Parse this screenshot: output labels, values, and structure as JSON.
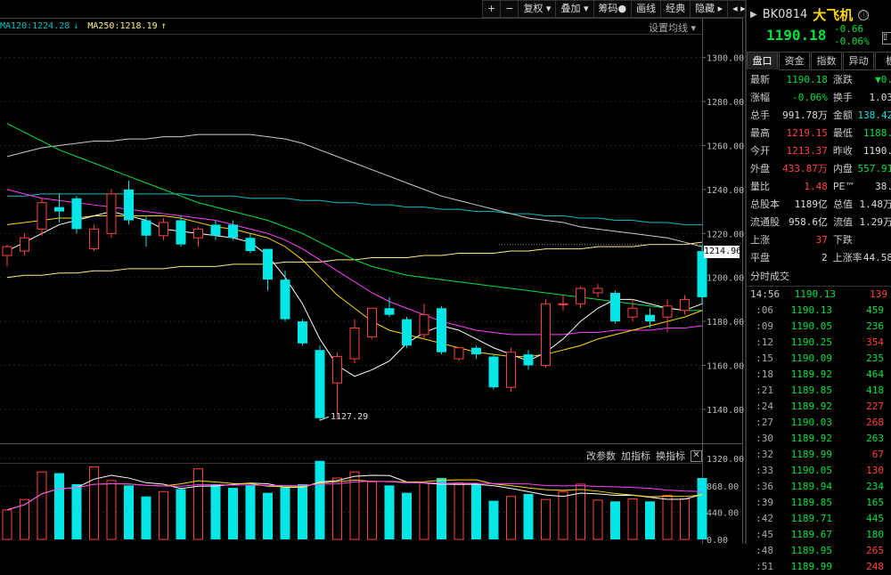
{
  "toolbar": {
    "buttons": [
      "+",
      "−",
      "复权 ▾",
      "叠加 ▾",
      "筹码●",
      "画线",
      "经典",
      "隐藏 ▸",
      "◂ ▸"
    ]
  },
  "legend": {
    "ma120": "MA120:1224.28",
    "ma120_arrow": "↓",
    "ma250": "MA250:1218.19",
    "ma250_arrow": "↑",
    "setting": "设置均线 ▾"
  },
  "colors": {
    "up": "#ff4040",
    "down": "#00e5e5",
    "ma5": "#ffffff",
    "ma10": "#ffd700",
    "ma20": "#ff40ff",
    "ma30": "#00e040",
    "ma60": "#cccccc",
    "ma120": "#00c0c0",
    "ma250": "#ffef80"
  },
  "current_price_tag": "1214.96",
  "min_label": "1127.29",
  "vol_tools": {
    "params": "改参数",
    "add": "加指标",
    "change": "换指标",
    "close": "✕"
  },
  "chart_data": {
    "type": "candlestick",
    "y_ticks": [
      "1300.00",
      "1280.00",
      "1260.00",
      "1240.00",
      "1220.00",
      "1200.00",
      "1180.00",
      "1160.00",
      "1140.00"
    ],
    "ylim": [
      1127,
      1310
    ],
    "vol_ticks": [
      "1320.00",
      "868.00",
      "440.00",
      "0.00"
    ],
    "vol_ylim": [
      0,
      1320
    ],
    "candles": [
      {
        "o": 1210,
        "h": 1215,
        "c": 1214,
        "l": 1205
      },
      {
        "o": 1212,
        "h": 1220,
        "c": 1218,
        "l": 1210
      },
      {
        "o": 1222,
        "h": 1236,
        "c": 1234,
        "l": 1219
      },
      {
        "o": 1232,
        "h": 1238,
        "c": 1230,
        "l": 1225
      },
      {
        "o": 1236,
        "h": 1237,
        "c": 1222,
        "l": 1220
      },
      {
        "o": 1213,
        "h": 1224,
        "c": 1222,
        "l": 1212
      },
      {
        "o": 1220,
        "h": 1240,
        "c": 1238,
        "l": 1218
      },
      {
        "o": 1240,
        "h": 1244,
        "c": 1226,
        "l": 1224
      },
      {
        "o": 1226,
        "h": 1228,
        "c": 1219,
        "l": 1214
      },
      {
        "o": 1219,
        "h": 1227,
        "c": 1225,
        "l": 1217
      },
      {
        "o": 1226,
        "h": 1228,
        "c": 1215,
        "l": 1214
      },
      {
        "o": 1218,
        "h": 1223,
        "c": 1222,
        "l": 1214
      },
      {
        "o": 1224,
        "h": 1226,
        "c": 1219,
        "l": 1217
      },
      {
        "o": 1224,
        "h": 1226,
        "c": 1218,
        "l": 1217
      },
      {
        "o": 1218,
        "h": 1220,
        "c": 1212,
        "l": 1211
      },
      {
        "o": 1213,
        "h": 1213,
        "c": 1199,
        "l": 1194
      },
      {
        "o": 1199,
        "h": 1203,
        "c": 1181,
        "l": 1180
      },
      {
        "o": 1180,
        "h": 1181,
        "c": 1170,
        "l": 1169
      },
      {
        "o": 1167,
        "h": 1169,
        "c": 1136,
        "l": 1135
      },
      {
        "o": 1152,
        "h": 1166,
        "c": 1164,
        "l": 1136
      },
      {
        "o": 1163,
        "h": 1181,
        "c": 1177,
        "l": 1161
      },
      {
        "o": 1173,
        "h": 1186,
        "c": 1186,
        "l": 1172
      },
      {
        "o": 1186,
        "h": 1191,
        "c": 1183,
        "l": 1182
      },
      {
        "o": 1181,
        "h": 1182,
        "c": 1169,
        "l": 1168
      },
      {
        "o": 1174,
        "h": 1188,
        "c": 1183,
        "l": 1172
      },
      {
        "o": 1186,
        "h": 1187,
        "c": 1166,
        "l": 1165
      },
      {
        "o": 1163,
        "h": 1165,
        "c": 1168,
        "l": 1162
      },
      {
        "o": 1168,
        "h": 1169,
        "c": 1165,
        "l": 1163
      },
      {
        "o": 1164,
        "h": 1165,
        "c": 1150,
        "l": 1149
      },
      {
        "o": 1150,
        "h": 1168,
        "c": 1166,
        "l": 1148
      },
      {
        "o": 1165,
        "h": 1167,
        "c": 1160,
        "l": 1158
      },
      {
        "o": 1160,
        "h": 1190,
        "c": 1188,
        "l": 1159
      },
      {
        "o": 1188,
        "h": 1192,
        "c": 1188,
        "l": 1185
      },
      {
        "o": 1188,
        "h": 1196,
        "c": 1195,
        "l": 1186
      },
      {
        "o": 1193,
        "h": 1197,
        "c": 1195,
        "l": 1191
      },
      {
        "o": 1193,
        "h": 1194,
        "c": 1180,
        "l": 1179
      },
      {
        "o": 1182,
        "h": 1190,
        "c": 1186,
        "l": 1180
      },
      {
        "o": 1183,
        "h": 1186,
        "c": 1180,
        "l": 1177
      },
      {
        "o": 1182,
        "h": 1190,
        "c": 1187,
        "l": 1175
      },
      {
        "o": 1185,
        "h": 1192,
        "c": 1190,
        "l": 1183
      },
      {
        "o": 1212,
        "h": 1215,
        "c": 1191,
        "l": 1188
      }
    ],
    "volumes": [
      480,
      650,
      1100,
      1080,
      900,
      1180,
      960,
      880,
      700,
      780,
      820,
      1150,
      900,
      840,
      880,
      760,
      860,
      900,
      1280,
      1000,
      1100,
      940,
      880,
      760,
      920,
      1000,
      920,
      900,
      630,
      700,
      740,
      650,
      780,
      900,
      640,
      620,
      660,
      620,
      720,
      660,
      1000
    ],
    "ma5": [
      1212,
      1216,
      1220,
      1224,
      1226,
      1228,
      1230,
      1228,
      1226,
      1222,
      1221,
      1220,
      1219,
      1218,
      1216,
      1210,
      1200,
      1188,
      1172,
      1160,
      1155,
      1158,
      1162,
      1170,
      1175,
      1178,
      1176,
      1172,
      1168,
      1165,
      1162,
      1166,
      1172,
      1180,
      1186,
      1190,
      1190,
      1188,
      1186,
      1185,
      1188
    ],
    "ma10": [
      1224,
      1225,
      1226,
      1227,
      1227,
      1228,
      1228,
      1228,
      1228,
      1228,
      1227,
      1225,
      1223,
      1222,
      1220,
      1218,
      1214,
      1208,
      1200,
      1192,
      1186,
      1180,
      1176,
      1174,
      1172,
      1170,
      1168,
      1166,
      1165,
      1164,
      1164,
      1165,
      1167,
      1169,
      1172,
      1174,
      1176,
      1178,
      1180,
      1182,
      1185
    ],
    "ma20": [
      1240,
      1238,
      1236,
      1235,
      1234,
      1233,
      1232,
      1231,
      1230,
      1229,
      1228,
      1227,
      1226,
      1224,
      1222,
      1220,
      1217,
      1213,
      1208,
      1203,
      1198,
      1193,
      1189,
      1186,
      1183,
      1180,
      1178,
      1176,
      1175,
      1174,
      1174,
      1174,
      1174,
      1175,
      1175,
      1176,
      1176,
      1176,
      1177,
      1177,
      1178
    ],
    "ma30": [
      1270,
      1266,
      1262,
      1258,
      1255,
      1252,
      1249,
      1246,
      1243,
      1240,
      1237,
      1234,
      1232,
      1230,
      1228,
      1226,
      1223,
      1220,
      1216,
      1212,
      1208,
      1205,
      1203,
      1201,
      1200,
      1199,
      1198,
      1197,
      1196,
      1195,
      1194,
      1193,
      1192,
      1191,
      1190,
      1189,
      1188,
      1187,
      1186,
      1185,
      1185
    ],
    "ma60": [
      1255,
      1257,
      1259,
      1260,
      1261,
      1262,
      1262,
      1263,
      1263,
      1264,
      1264,
      1265,
      1265,
      1265,
      1265,
      1264,
      1263,
      1261,
      1258,
      1255,
      1252,
      1249,
      1246,
      1243,
      1240,
      1237,
      1235,
      1233,
      1231,
      1229,
      1227,
      1226,
      1225,
      1223,
      1222,
      1221,
      1220,
      1219,
      1218,
      1216,
      1214
    ],
    "ma120": [
      1237,
      1237,
      1238,
      1238,
      1238,
      1238,
      1238,
      1238,
      1238,
      1238,
      1238,
      1237,
      1237,
      1237,
      1236,
      1236,
      1236,
      1235,
      1235,
      1234,
      1234,
      1233,
      1233,
      1232,
      1232,
      1231,
      1231,
      1230,
      1230,
      1229,
      1229,
      1228,
      1228,
      1227,
      1227,
      1226,
      1226,
      1225,
      1225,
      1224,
      1224
    ],
    "ma250": [
      1200,
      1201,
      1201,
      1202,
      1202,
      1203,
      1203,
      1204,
      1204,
      1204,
      1205,
      1205,
      1205,
      1206,
      1206,
      1206,
      1207,
      1207,
      1207,
      1208,
      1208,
      1209,
      1209,
      1209,
      1210,
      1210,
      1211,
      1211,
      1211,
      1212,
      1212,
      1213,
      1213,
      1213,
      1214,
      1214,
      1214,
      1215,
      1215,
      1215,
      1216
    ]
  },
  "side": {
    "code": "BK0814",
    "name": "大飞机",
    "info_icon": "ⓘ",
    "price": "1190.18",
    "change": "-0.66",
    "change_pct": "-0.06%",
    "collapse": "▯",
    "tabs": [
      "盘口",
      "资金",
      "指数",
      "异动",
      "板"
    ],
    "quote": [
      {
        "l1": "最新",
        "v1": "1190.18",
        "c1": "green",
        "l2": "涨跌",
        "v2": "▼0.",
        "c2": "green"
      },
      {
        "l1": "涨幅",
        "v1": "-0.06%",
        "c1": "green",
        "l2": "换手",
        "v2": "1.03",
        "c2": "white"
      },
      {
        "l1": "总手",
        "v1": "991.78万",
        "c1": "white",
        "l2": "金额",
        "v2": "138.42",
        "c2": "cyan"
      },
      {
        "l1": "最高",
        "v1": "1219.15",
        "c1": "red",
        "l2": "最低",
        "v2": "1188.",
        "c2": "green"
      },
      {
        "l1": "今开",
        "v1": "1213.37",
        "c1": "red",
        "l2": "昨收",
        "v2": "1190.",
        "c2": "white"
      },
      {
        "l1": "外盘",
        "v1": "433.87万",
        "c1": "red",
        "l2": "内盘",
        "v2": "557.91",
        "c2": "green"
      },
      {
        "l1": "量比",
        "v1": "1.48",
        "c1": "red",
        "l2": "PE™",
        "v2": "38.",
        "c2": "white"
      },
      {
        "l1": "总股本",
        "v1": "1189亿",
        "c1": "white",
        "l2": "总值",
        "v2": "1.48万",
        "c2": "white"
      },
      {
        "l1": "流通股",
        "v1": "958.6亿",
        "c1": "white",
        "l2": "流值",
        "v2": "1.29万",
        "c2": "white"
      },
      {
        "l1": "上涨",
        "v1": "37",
        "c1": "red",
        "l2": "下跌",
        "v2": "",
        "c2": "green"
      },
      {
        "l1": "平盘",
        "v1": "2",
        "c1": "white",
        "l2": "上涨率",
        "v2": "44.58",
        "c2": "white"
      }
    ],
    "ticks_title": "分时成交",
    "ticks": [
      {
        "t": "14:56",
        "p": "1190.13",
        "q": "139",
        "c": "red"
      },
      {
        "t": ":06",
        "p": "1190.13",
        "q": "459",
        "c": "green"
      },
      {
        "t": ":09",
        "p": "1190.05",
        "q": "236",
        "c": "green"
      },
      {
        "t": ":12",
        "p": "1190.25",
        "q": "354",
        "c": "red"
      },
      {
        "t": ":15",
        "p": "1190.09",
        "q": "235",
        "c": "green"
      },
      {
        "t": ":18",
        "p": "1189.92",
        "q": "464",
        "c": "green"
      },
      {
        "t": ":21",
        "p": "1189.85",
        "q": "418",
        "c": "green"
      },
      {
        "t": ":24",
        "p": "1189.92",
        "q": "227",
        "c": "red"
      },
      {
        "t": ":27",
        "p": "1190.03",
        "q": "268",
        "c": "red"
      },
      {
        "t": ":30",
        "p": "1189.92",
        "q": "263",
        "c": "green"
      },
      {
        "t": ":32",
        "p": "1189.99",
        "q": "67",
        "c": "red"
      },
      {
        "t": ":33",
        "p": "1190.05",
        "q": "130",
        "c": "red"
      },
      {
        "t": ":36",
        "p": "1189.94",
        "q": "234",
        "c": "green"
      },
      {
        "t": ":39",
        "p": "1189.85",
        "q": "165",
        "c": "green"
      },
      {
        "t": ":42",
        "p": "1189.71",
        "q": "445",
        "c": "green"
      },
      {
        "t": ":45",
        "p": "1189.67",
        "q": "180",
        "c": "green"
      },
      {
        "t": ":48",
        "p": "1189.95",
        "q": "265",
        "c": "red"
      },
      {
        "t": ":51",
        "p": "1189.99",
        "q": "248",
        "c": "red"
      }
    ]
  }
}
